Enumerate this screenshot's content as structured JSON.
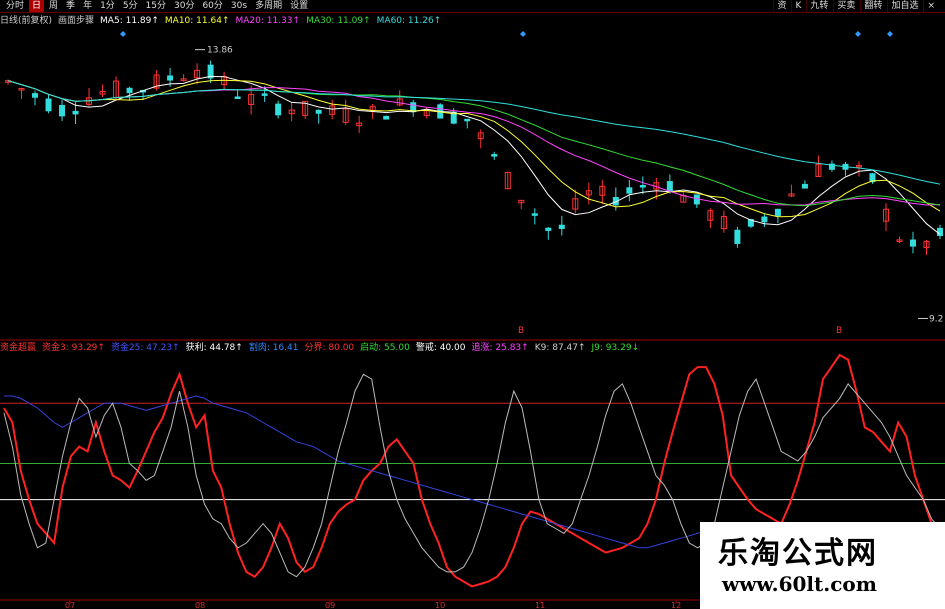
{
  "toolbar": {
    "left": [
      {
        "label": "分时",
        "active": false
      },
      {
        "label": "日",
        "active": true
      },
      {
        "label": "周",
        "active": false
      },
      {
        "label": "季",
        "active": false
      },
      {
        "label": "年",
        "active": false
      },
      {
        "label": "1分",
        "active": false
      },
      {
        "label": "5分",
        "active": false
      },
      {
        "label": "15分",
        "active": false
      },
      {
        "label": "30分",
        "active": false
      },
      {
        "label": "60分",
        "active": false
      },
      {
        "label": "30s",
        "active": false
      },
      {
        "label": "多周期",
        "active": false
      },
      {
        "label": "设置",
        "active": false
      }
    ],
    "right": [
      "资",
      "K",
      "九转",
      "买卖",
      "翻转",
      "加自选",
      "×"
    ]
  },
  "ma_legend": [
    {
      "text": "日线(前复权)",
      "color": "#cccccc"
    },
    {
      "text": "画面步骤",
      "color": "#cccccc"
    },
    {
      "text": "MA5: 11.89↑",
      "color": "#ffffff"
    },
    {
      "text": "MA10: 11.64↑",
      "color": "#ffff33"
    },
    {
      "text": "MA20: 11.33↑",
      "color": "#ff44ff"
    },
    {
      "text": "MA30: 11.09↑",
      "color": "#33dd33"
    },
    {
      "text": "MA60: 11.26↑",
      "color": "#33dddd"
    }
  ],
  "indicator_legend": [
    {
      "text": "资金超赢",
      "color": "#ff3333"
    },
    {
      "text": "资金3: 93.29↑",
      "color": "#ff3333"
    },
    {
      "text": "资金25: 47.23↑",
      "color": "#4455ff"
    },
    {
      "text": "获利: 44.78↑",
      "color": "#ffffff"
    },
    {
      "text": "割肉: 16.41",
      "color": "#3388ff"
    },
    {
      "text": "分界: 80.00",
      "color": "#ff3333"
    },
    {
      "text": "启动: 55.00",
      "color": "#33dd33"
    },
    {
      "text": "警戒: 40.00",
      "color": "#ffffff"
    },
    {
      "text": "追涨: 25.83↑",
      "color": "#ff44ff"
    },
    {
      "text": "K9: 87.47↑",
      "color": "#cccccc"
    },
    {
      "text": "J9: 93.29↓",
      "color": "#33dd33"
    }
  ],
  "price_labels": {
    "high": "13.86",
    "low": "9.2"
  },
  "signal_labels": [
    "B",
    "B"
  ],
  "xaxis_labels": [
    "07",
    "08",
    "09",
    "10",
    "11",
    "12"
  ],
  "watermark": {
    "title": "乐淘公式网",
    "url": "www.60lt.com"
  },
  "colors": {
    "up": "#ff3333",
    "down": "#33dddd",
    "ma5": "#ffffff",
    "ma10": "#ffff33",
    "ma20": "#ff44ff",
    "ma30": "#33dd33",
    "ma60": "#33dddd",
    "frame": "#990000"
  },
  "chart_data": {
    "type": "line",
    "candles": {
      "ylim": [
        9.0,
        14.2
      ],
      "count": 70,
      "key_points": [
        [
          0,
          13.3
        ],
        [
          6,
          12.8
        ],
        [
          9,
          13.1
        ],
        [
          14,
          13.2
        ],
        [
          20,
          13.55
        ],
        [
          25,
          13.0
        ],
        [
          31,
          12.8
        ],
        [
          37,
          12.7
        ],
        [
          42,
          12.95
        ],
        [
          48,
          12.65
        ],
        [
          52,
          11.6
        ],
        [
          55,
          11.0
        ],
        [
          57,
          10.6
        ],
        [
          60,
          11.35
        ],
        [
          63,
          11.3
        ],
        [
          66,
          11.5
        ],
        [
          67,
          11.55
        ],
        [
          68,
          11.65
        ],
        [
          70,
          11.35
        ],
        [
          72,
          11.15
        ],
        [
          74,
          10.9
        ],
        [
          76,
          10.6
        ],
        [
          79,
          11.0
        ],
        [
          82,
          11.4
        ],
        [
          85,
          11.9
        ],
        [
          87,
          11.8
        ],
        [
          90,
          11.6
        ],
        [
          92,
          10.75
        ],
        [
          94,
          10.4
        ],
        [
          97,
          10.6
        ]
      ],
      "high": 13.86,
      "low": 9.2
    },
    "oscillator": {
      "ylim": [
        0,
        100
      ],
      "levels": [
        {
          "name": "分界",
          "value": 80
        },
        {
          "name": "启动",
          "value": 55
        },
        {
          "name": "警戒",
          "value": 40
        }
      ],
      "series": [
        {
          "name": "资金3",
          "values": [
            78,
            72,
            52,
            40,
            30,
            26,
            22,
            45,
            58,
            62,
            60,
            72,
            60,
            50,
            48,
            45,
            52,
            60,
            68,
            74,
            84,
            92,
            80,
            70,
            75,
            52,
            45,
            30,
            18,
            10,
            8,
            12,
            20,
            30,
            24,
            14,
            10,
            12,
            20,
            30,
            35,
            38,
            40,
            48,
            52,
            55,
            62,
            65,
            60,
            55,
            40,
            30,
            22,
            12,
            8,
            6,
            4,
            5,
            6,
            8,
            12,
            20,
            30,
            35,
            34,
            32,
            30,
            28,
            26,
            24,
            22,
            20,
            18,
            19,
            20,
            22,
            24,
            30,
            40,
            55,
            68,
            80,
            92,
            95,
            95,
            88,
            75,
            50,
            45,
            40,
            36,
            34,
            32,
            30,
            38,
            48,
            60,
            72,
            90,
            95,
            100,
            98,
            85,
            70,
            68,
            64,
            60,
            72,
            66,
            50,
            40,
            30,
            22
          ]
        },
        {
          "name": "资金25",
          "values": [
            83,
            83,
            82,
            80,
            78,
            75,
            72,
            70,
            72,
            74,
            76,
            78,
            80,
            80,
            80,
            79,
            78,
            77,
            78,
            79,
            80,
            81,
            82,
            83,
            82,
            80,
            79,
            78,
            77,
            76,
            74,
            72,
            70,
            68,
            66,
            64,
            63,
            62,
            60,
            58,
            56,
            55,
            54,
            53,
            52,
            51,
            50,
            49,
            48,
            47,
            46,
            45,
            44,
            43,
            42,
            41,
            40,
            39,
            38,
            37,
            36,
            35,
            34,
            33,
            32,
            31,
            30,
            29,
            28,
            27,
            26,
            25,
            24,
            23,
            22,
            21,
            20,
            20,
            21,
            22,
            23,
            24,
            25,
            26,
            27,
            26,
            25,
            24,
            22,
            20,
            18,
            16,
            14,
            12,
            10,
            9,
            8,
            8,
            8,
            9,
            10,
            11,
            12,
            13,
            14,
            15,
            16,
            17,
            16,
            15,
            14,
            13,
            12
          ]
        },
        {
          "name": "获利",
          "values": [
            76,
            62,
            42,
            30,
            20,
            22,
            40,
            58,
            72,
            82,
            78,
            66,
            75,
            80,
            70,
            55,
            52,
            48,
            50,
            60,
            70,
            85,
            70,
            50,
            38,
            32,
            30,
            24,
            20,
            22,
            26,
            30,
            26,
            18,
            10,
            8,
            12,
            20,
            30,
            45,
            60,
            72,
            85,
            92,
            90,
            70,
            52,
            40,
            32,
            26,
            20,
            16,
            12,
            10,
            10,
            12,
            18,
            28,
            40,
            55,
            72,
            85,
            78,
            60,
            40,
            30,
            28,
            26,
            30,
            40,
            50,
            62,
            75,
            85,
            88,
            80,
            70,
            60,
            50,
            46,
            40,
            30,
            22,
            20,
            22,
            30,
            45,
            60,
            75,
            85,
            90,
            80,
            70,
            60,
            58,
            56,
            60,
            66,
            74,
            78,
            82,
            88,
            84,
            80,
            76,
            72,
            66,
            58,
            50,
            45,
            40,
            32,
            28
          ]
        }
      ]
    }
  }
}
